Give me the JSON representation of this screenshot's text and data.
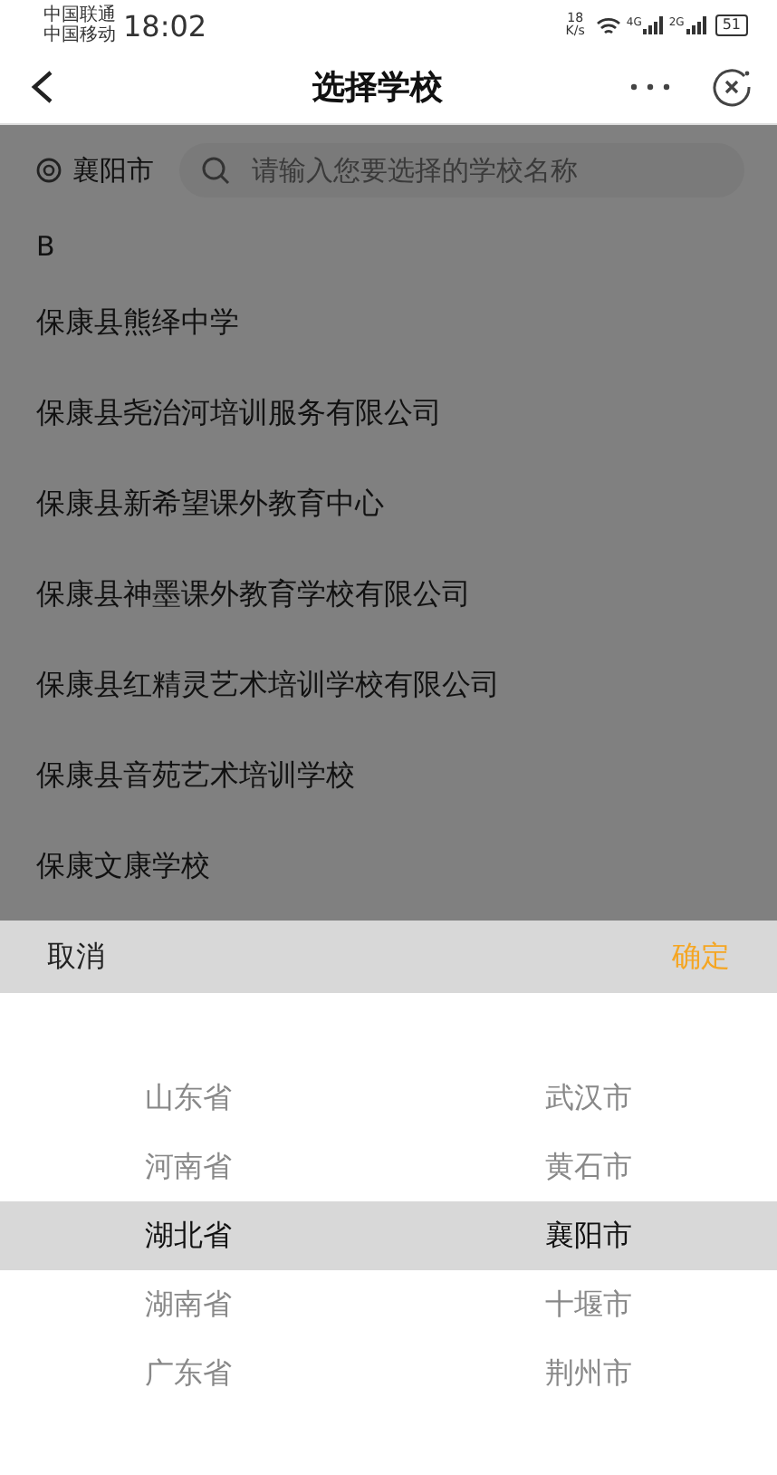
{
  "status_bar": {
    "carriers": [
      "中国联通",
      "中国移动"
    ],
    "time": "18:02",
    "net_speed": [
      "18",
      "K/s"
    ],
    "sim_labels": [
      "4G",
      "2G"
    ],
    "battery": "51"
  },
  "nav": {
    "title": "选择学校"
  },
  "search_row": {
    "location": "襄阳市",
    "placeholder": "请输入您要选择的学校名称"
  },
  "section": "B",
  "schools": [
    "保康县熊绎中学",
    "保康县尧治河培训服务有限公司",
    "保康县新希望课外教育中心",
    "保康县神墨课外教育学校有限公司",
    "保康县红精灵艺术培训学校有限公司",
    "保康县音苑艺术培训学校",
    "保康文康学校"
  ],
  "picker": {
    "cancel": "取消",
    "confirm": "确定",
    "rows": [
      {
        "province": "山东省",
        "city": "武汉市",
        "selected": false
      },
      {
        "province": "河南省",
        "city": "黄石市",
        "selected": false
      },
      {
        "province": "湖北省",
        "city": "襄阳市",
        "selected": true
      },
      {
        "province": "湖南省",
        "city": "十堰市",
        "selected": false
      },
      {
        "province": "广东省",
        "city": "荆州市",
        "selected": false
      }
    ]
  }
}
